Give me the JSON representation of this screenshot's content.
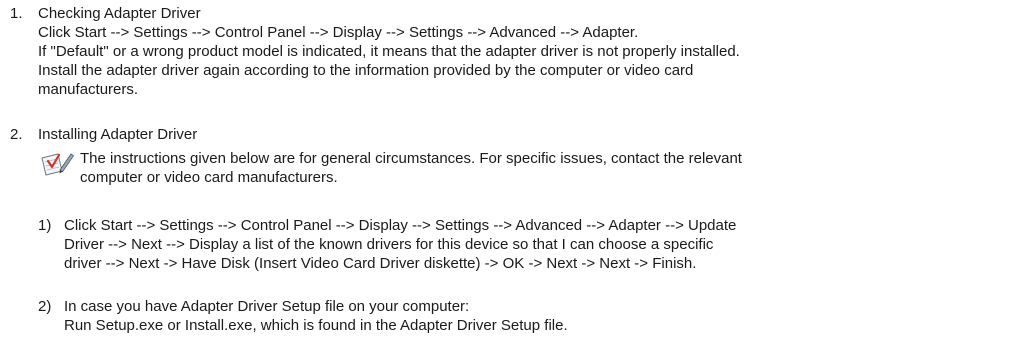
{
  "steps": [
    {
      "number": "1.",
      "title": "Checking Adapter Driver",
      "lines": [
        "Click Start --> Settings --> Control Panel --> Display --> Settings --> Advanced --> Adapter.",
        "If \"Default\" or a wrong product model is indicated, it means that the adapter driver is not properly installed.",
        "Install the adapter driver again according to the information provided by the computer or video card",
        "manufacturers."
      ]
    },
    {
      "number": "2.",
      "title": "Installing Adapter Driver",
      "note": {
        "icon": "note-pencil-checkmark-icon",
        "lines": [
          "The instructions given below are for general circumstances. For specific issues, contact the relevant",
          "computer or video card manufacturers."
        ]
      },
      "substeps": [
        {
          "number": "1)",
          "lines": [
            "Click Start --> Settings --> Control Panel --> Display --> Settings --> Advanced --> Adapter --> Update",
            "Driver --> Next --> Display a list of the known drivers for this device so that I can choose a specific",
            "driver --> Next -> Have Disk (Insert Video Card Driver diskette) -> OK -> Next -> Next -> Finish."
          ]
        },
        {
          "number": "2)",
          "lines": [
            "In case you have Adapter Driver Setup file on your computer:",
            "Run Setup.exe or Install.exe, which is found in the Adapter Driver Setup file."
          ]
        }
      ]
    }
  ]
}
